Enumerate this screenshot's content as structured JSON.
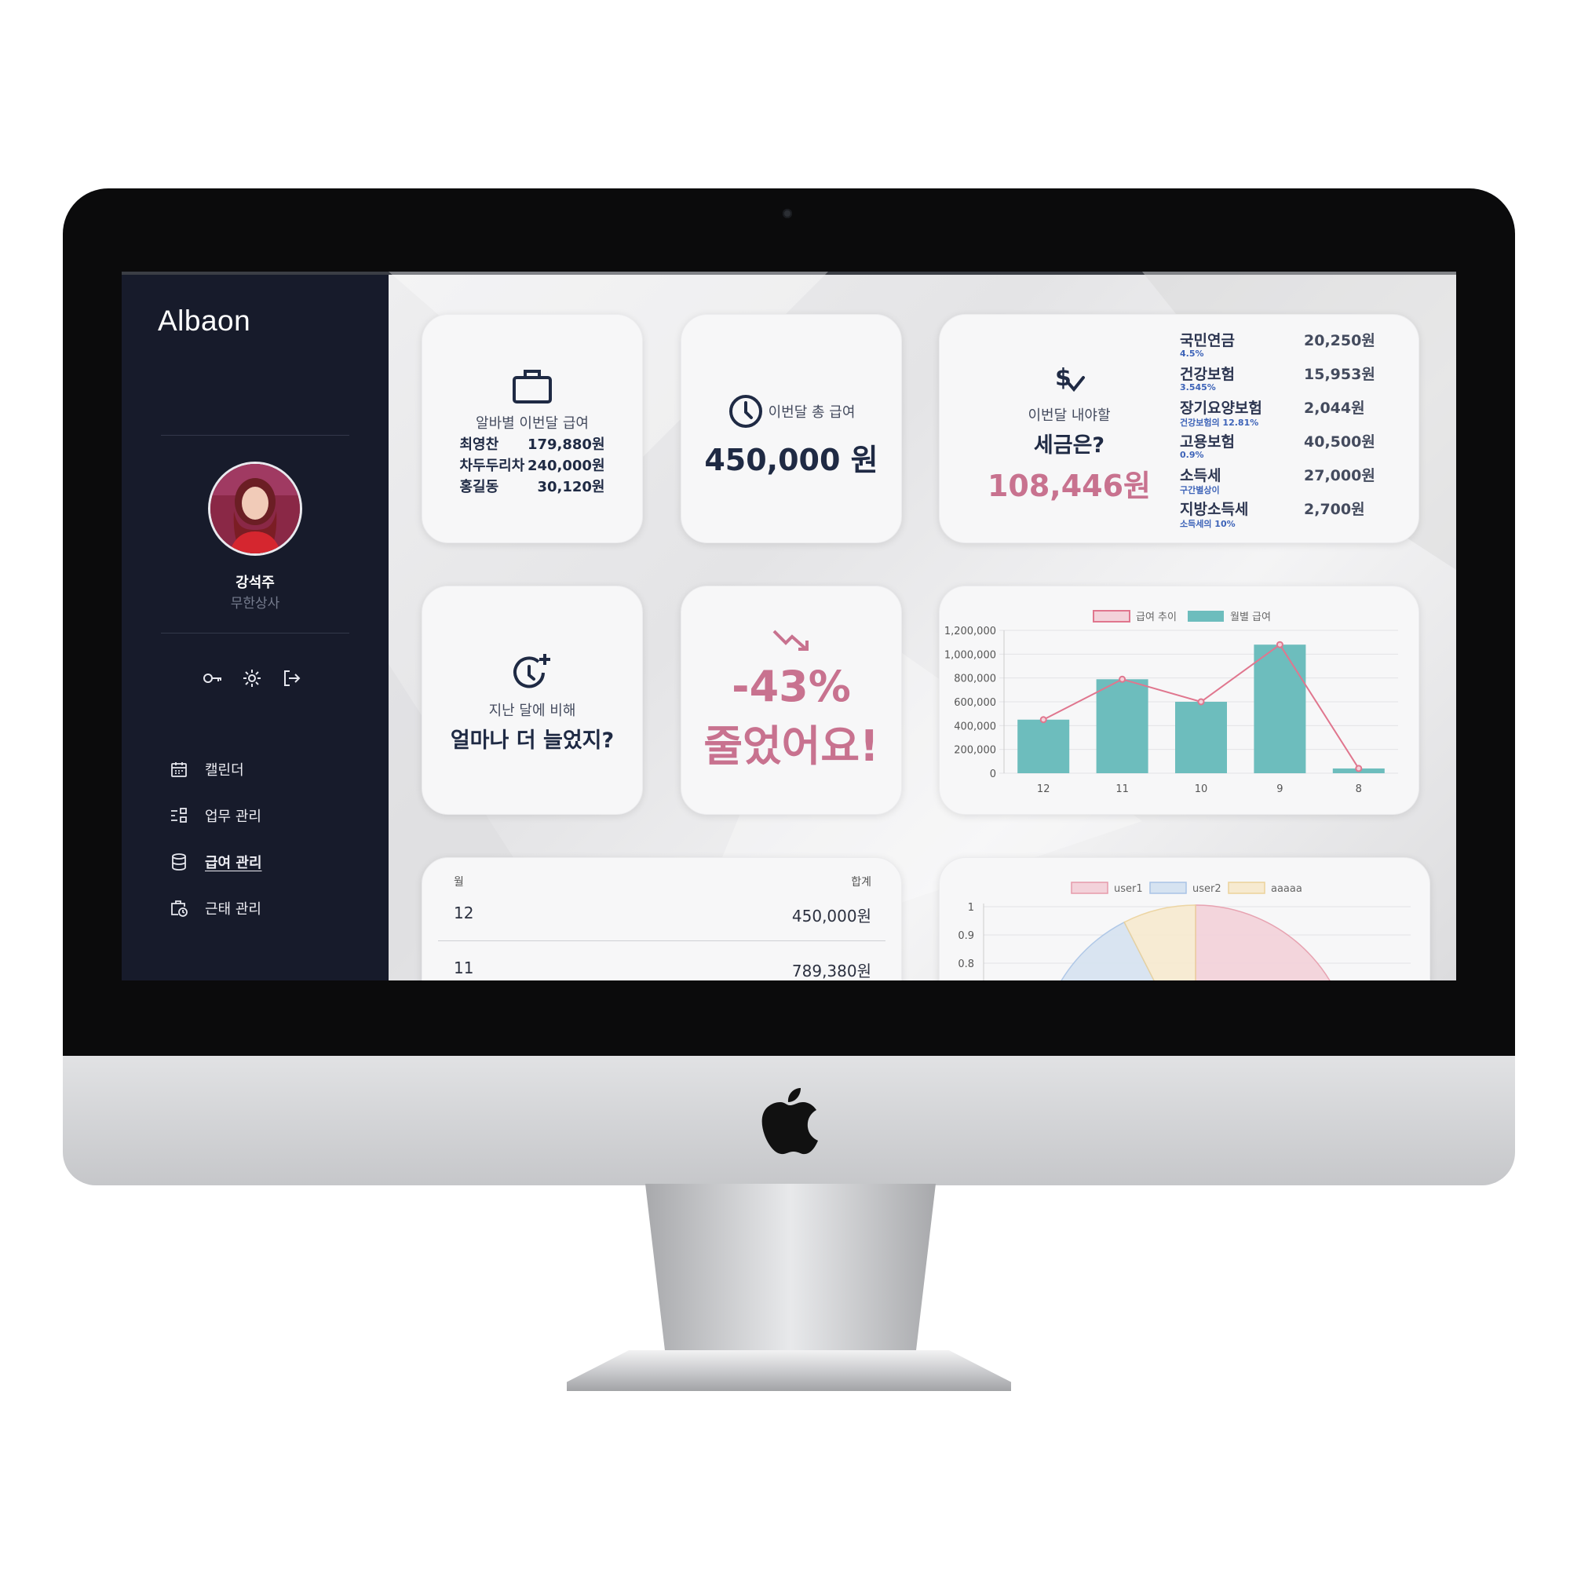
{
  "app": {
    "logo_text": "Albaon"
  },
  "user": {
    "name": "강석주",
    "company": "무한상사"
  },
  "quick_actions": [
    {
      "icon": "key-icon"
    },
    {
      "icon": "gear-icon"
    },
    {
      "icon": "logout-icon"
    }
  ],
  "nav": {
    "items": [
      {
        "label": "캘린더",
        "icon": "calendar-icon",
        "active": false
      },
      {
        "label": "업무 관리",
        "icon": "task-list-icon",
        "active": false
      },
      {
        "label": "급여 관리",
        "icon": "database-icon",
        "active": true
      },
      {
        "label": "근태 관리",
        "icon": "briefcase-clock-icon",
        "active": false
      }
    ]
  },
  "cards": {
    "by_job": {
      "title": "알바별 이번달 급여",
      "rows": [
        {
          "name": "최영찬",
          "amount": "179,880원"
        },
        {
          "name": "차두두리차",
          "amount": "240,000원"
        },
        {
          "name": "홍길동",
          "amount": "30,120원"
        }
      ]
    },
    "total": {
      "label": "이번달 총 급여",
      "value": "450,000 원"
    },
    "tax": {
      "label": "이번달 내야할",
      "question": "세금은?",
      "total": "108,446원",
      "items": [
        {
          "name": "국민연금",
          "rate": "4.5%",
          "amount": "20,250원"
        },
        {
          "name": "건강보험",
          "rate": "3.545%",
          "amount": "15,953원"
        },
        {
          "name": "장기요양보험",
          "rate": "건강보험의 12.81%",
          "amount": "2,044원"
        },
        {
          "name": "고용보험",
          "rate": "0.9%",
          "amount": "40,500원"
        },
        {
          "name": "소득세",
          "rate": "구간별상이",
          "amount": "27,000원"
        },
        {
          "name": "지방소득세",
          "rate": "소득세의 10%",
          "amount": "2,700원"
        }
      ]
    },
    "compare": {
      "label": "지난 달에 비해",
      "question": "얼마나 더 늘었지?"
    },
    "change": {
      "percent": "-43%",
      "text": "줄었어요!"
    },
    "history": {
      "col_month": "월",
      "col_total": "합계",
      "rows": [
        {
          "month": "12",
          "total": "450,000원"
        },
        {
          "month": "11",
          "total": "789,380원"
        }
      ]
    }
  },
  "colors": {
    "accent_pink": "#c8728f",
    "navy": "#1f2a44",
    "teal": "#6dbdbd",
    "line": "#e0768e",
    "sidebar": "#171b2b"
  },
  "chart_data": [
    {
      "type": "bar",
      "categories": [
        "12",
        "11",
        "10",
        "9",
        "8"
      ],
      "series": [
        {
          "name": "급여 추이",
          "type": "line",
          "values": [
            450000,
            789380,
            600000,
            1080000,
            40000
          ]
        },
        {
          "name": "월별 급여",
          "type": "bar",
          "values": [
            450000,
            789380,
            600000,
            1080000,
            40000
          ]
        }
      ],
      "ylim": [
        0,
        1200000
      ],
      "yticks": [
        "0",
        "200,000",
        "400,000",
        "600,000",
        "800,000",
        "1,000,000",
        "1,200,000"
      ],
      "grid": true,
      "legend": "top-center"
    },
    {
      "type": "pie",
      "labels": [
        "user1",
        "user2",
        "aaaaa"
      ],
      "yticks": [
        "0.8",
        "0.9",
        "1"
      ],
      "legend": "top-center"
    }
  ]
}
